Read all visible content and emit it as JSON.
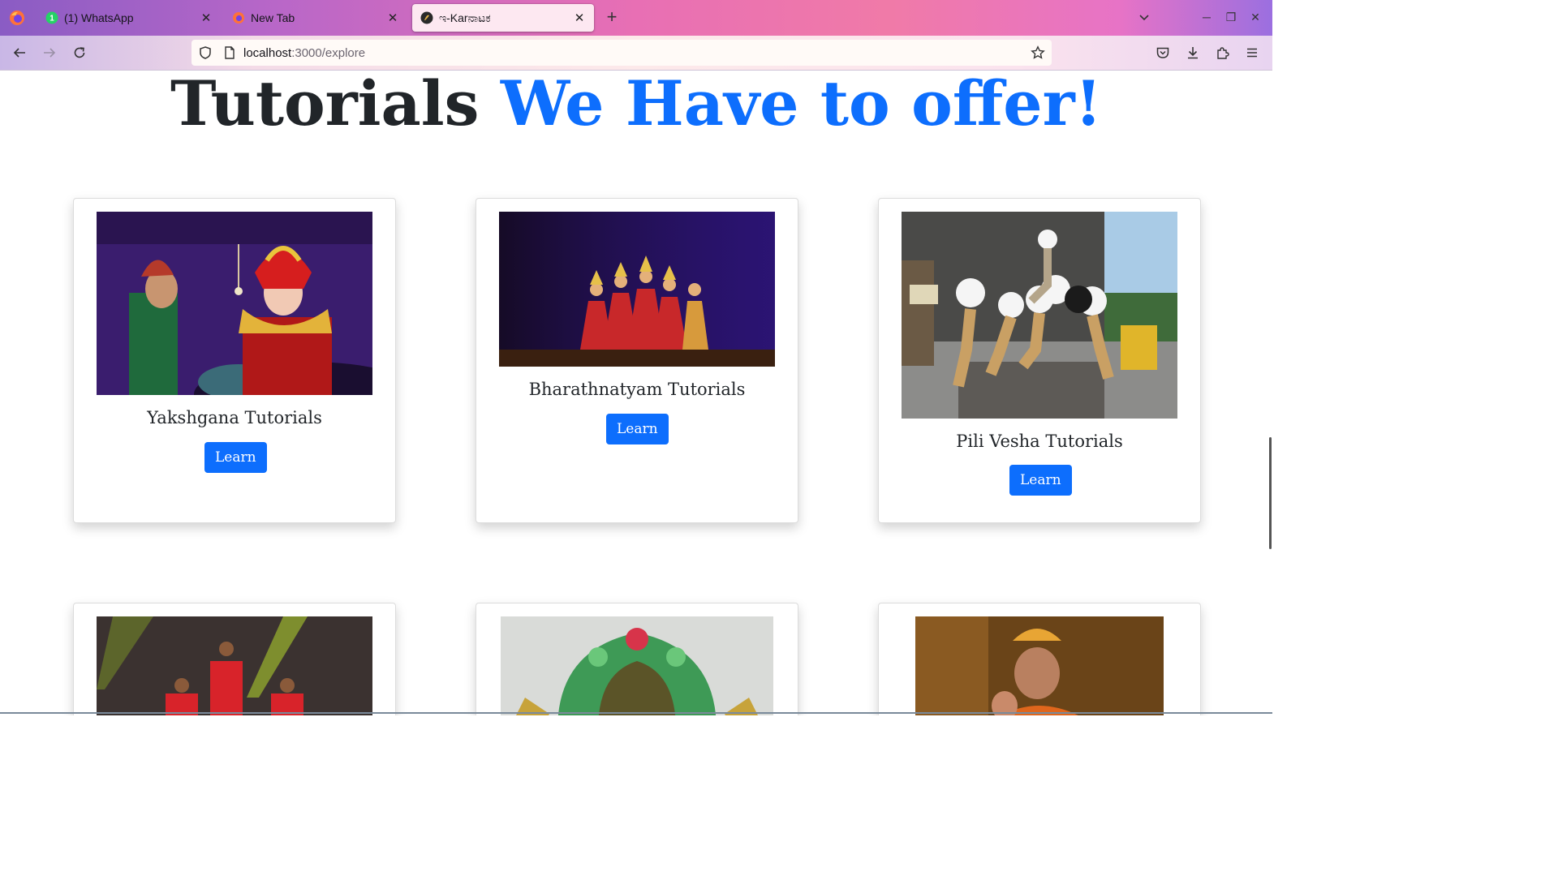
{
  "browser": {
    "tabs": [
      {
        "title": "(1) WhatsApp",
        "badge": "1"
      },
      {
        "title": "New Tab"
      },
      {
        "title": "ಇ-Karನಾಟಕ",
        "active": true
      }
    ],
    "url_host": "localhost",
    "url_path": ":3000/explore"
  },
  "page": {
    "heading_dark": "Tutorials",
    "heading_accent": "We Have to offer!",
    "cards": [
      {
        "title": "Yakshgana Tutorials",
        "button": "Learn"
      },
      {
        "title": "Bharathnatyam Tutorials",
        "button": "Learn"
      },
      {
        "title": "Pili Vesha Tutorials",
        "button": "Learn"
      }
    ]
  },
  "colors": {
    "accent": "#0d6efd",
    "text": "#212529"
  }
}
